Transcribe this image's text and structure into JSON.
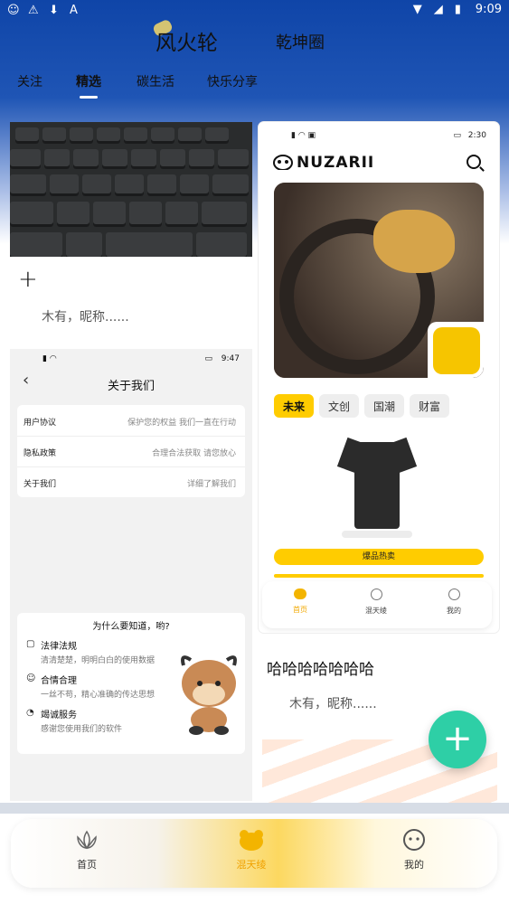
{
  "status_bar": {
    "time": "9:09"
  },
  "header": {
    "app_logo": "风火轮",
    "circle_title": "乾坤圈"
  },
  "tabs": [
    {
      "label": "关注"
    },
    {
      "label": "精选",
      "active": true
    },
    {
      "label": "碳生活"
    },
    {
      "label": "快乐分享"
    }
  ],
  "feed_left": {
    "nickname": "木有，昵称......",
    "about_screenshot": {
      "time": "9:47",
      "title": "关于我们",
      "rows": [
        {
          "label": "用户协议",
          "value": "保护您的权益 我们一直在行动"
        },
        {
          "label": "隐私政策",
          "value": "合理合法获取 请您放心"
        },
        {
          "label": "关于我们",
          "value": "详细了解我们"
        }
      ],
      "why_title": "为什么要知道，哟?",
      "why_items": [
        {
          "title": "法律法规",
          "sub": "清清楚楚，明明白白的使用数据"
        },
        {
          "title": "合情合理",
          "sub": "一丝不苟，精心准确的传达思想"
        },
        {
          "title": "竭诚服务",
          "sub": "感谢您使用我们的软件"
        }
      ]
    }
  },
  "feed_right": {
    "screenshot": {
      "time": "2:30",
      "brand": "NUZARII",
      "chips": [
        "未来",
        "文创",
        "国潮",
        "财富"
      ],
      "hot_label": "爆品热卖",
      "nav": [
        {
          "label": "首页",
          "active": true
        },
        {
          "label": "混天绫"
        },
        {
          "label": "我的"
        }
      ]
    },
    "title": "哈哈哈哈哈哈哈",
    "nickname": "木有，昵称......"
  },
  "fab": {
    "icon": "plus-icon"
  },
  "bottom_nav": [
    {
      "label": "首页",
      "icon": "lotus-icon"
    },
    {
      "label": "混天绫",
      "icon": "bear-icon",
      "active": true
    },
    {
      "label": "我的",
      "icon": "smiley-icon"
    }
  ],
  "colors": {
    "brand_blue": "#0f45a8",
    "accent_yellow": "#ffcc00",
    "fab_green": "#2ecfa6",
    "active_orange": "#f0a200"
  }
}
